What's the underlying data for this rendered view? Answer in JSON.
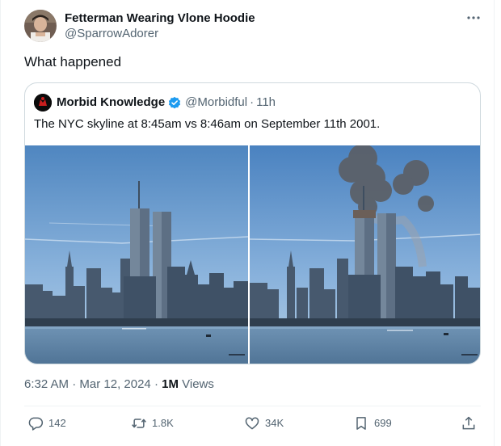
{
  "author": {
    "name": "Fetterman Wearing Vlone Hoodie",
    "handle": "@SparrowAdorer"
  },
  "tweet": {
    "text": "What happened"
  },
  "quote": {
    "name": "Morbid Knowledge",
    "handle": "@Morbidful",
    "separator": "·",
    "time": "11h",
    "text": "The NYC skyline at 8:45am vs 8:46am on September 11th 2001."
  },
  "meta": {
    "time": "6:32 AM",
    "sep1": " · ",
    "date": "Mar 12, 2024",
    "sep2": " · ",
    "views_count": "1M",
    "views_label": " Views"
  },
  "actions": {
    "replies": "142",
    "reposts": "1.8K",
    "likes": "34K",
    "bookmarks": "699"
  },
  "icons": {
    "more": "more-horizontal-icon",
    "verified": "verified-badge-icon",
    "reply": "reply-icon",
    "repost": "repost-icon",
    "like": "like-icon",
    "bookmark": "bookmark-icon",
    "share": "share-icon"
  },
  "colors": {
    "text_primary": "#0f1419",
    "text_secondary": "#536471",
    "border": "#cfd9de",
    "verified": "#1d9bf0"
  }
}
